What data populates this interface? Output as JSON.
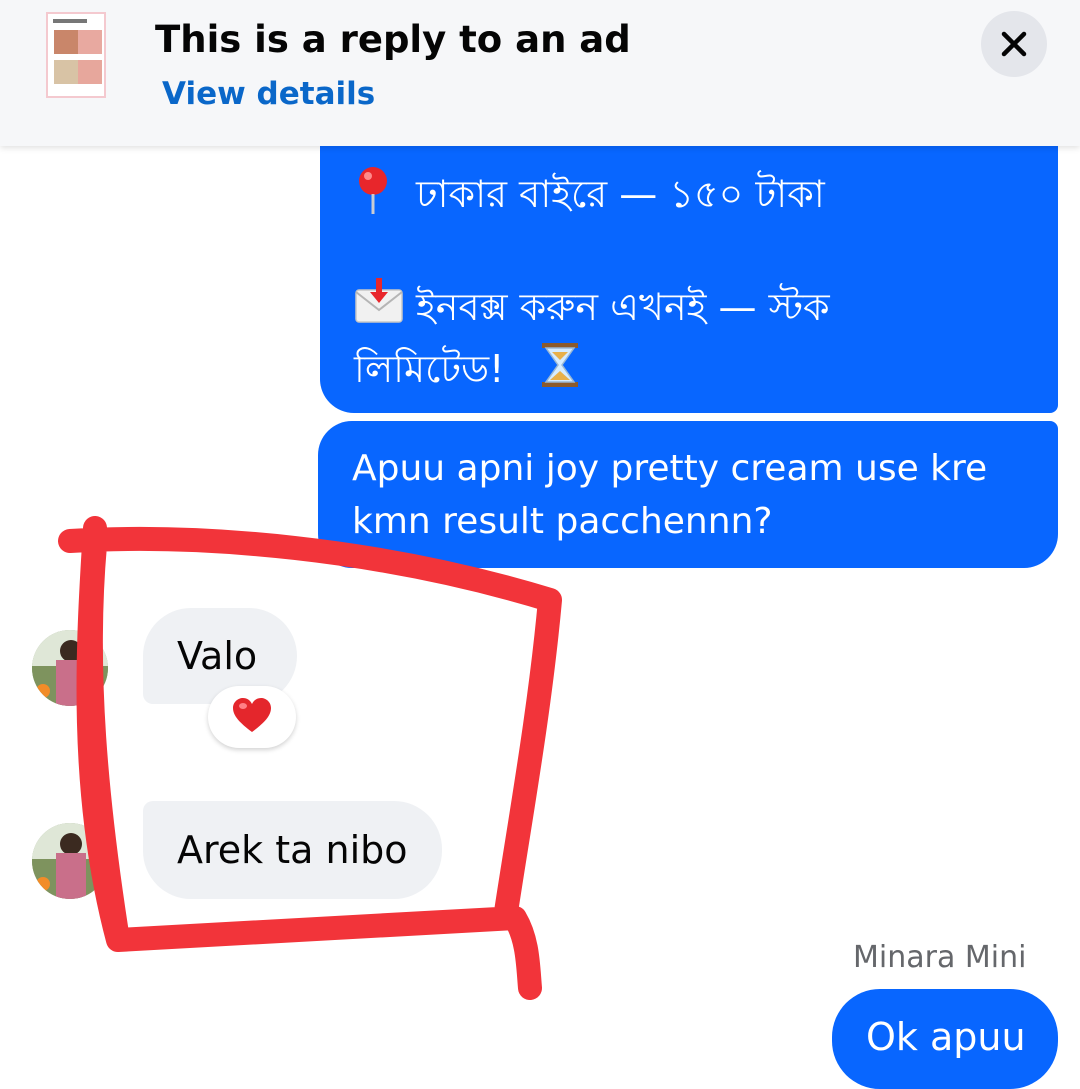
{
  "banner": {
    "title": "This is a reply to an ad",
    "link": "View details",
    "close_icon": "close-icon"
  },
  "messages": {
    "ad_post": {
      "line1": "ঢাকার বাইরে — ১৫০ টাকা",
      "line2": "ইনবক্স করুন এখনই — স্টক",
      "line3": "লিমিটেড!",
      "icons": [
        "round-pushpin-icon",
        "envelope-with-arrow-icon",
        "hourglass-icon"
      ]
    },
    "question": {
      "line1": "Apuu apni joy pretty cream use kre",
      "line2": "kmn result pacchennn?"
    },
    "reply1": {
      "text": "Valo",
      "reaction": "heart-reaction-icon"
    },
    "reply2": {
      "text": "Arek ta nibo"
    },
    "sender": "Minara Mini",
    "outgoing_last": "Ok apuu"
  },
  "colors": {
    "outgoing_bubble": "#0866ff",
    "incoming_bubble": "#eff1f4",
    "link": "#0a67c9",
    "annotation": "#f2343a"
  }
}
